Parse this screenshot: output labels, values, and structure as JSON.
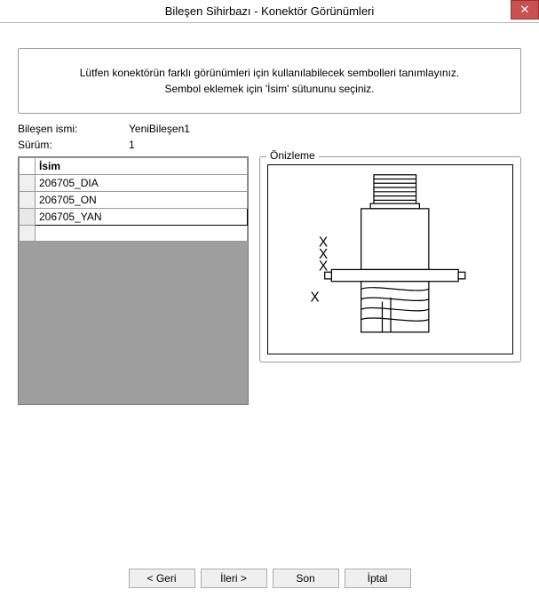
{
  "window": {
    "title": "Bileşen Sihirbazı - Konektör Görünümleri"
  },
  "instructions": {
    "line1": "Lütfen konektörün farklı görünümleri için kullanılabilecek sembolleri tanımlayınız.",
    "line2": "Sembol eklemek için 'İsim' sütununu seçiniz."
  },
  "info": {
    "name_label": "Bileşen ismi:",
    "name_value": "YeniBileşen1",
    "version_label": "Sürüm:",
    "version_value": "1"
  },
  "grid": {
    "col_name": "İsim",
    "rows": [
      {
        "name": "206705_DIA"
      },
      {
        "name": "206705_ON"
      },
      {
        "name": "206705_YAN"
      },
      {
        "name": ""
      }
    ],
    "selected_index": 2
  },
  "preview": {
    "title": "Önizleme"
  },
  "buttons": {
    "back": "< Geri",
    "next": "İleri >",
    "finish": "Son",
    "cancel": "İptal"
  }
}
